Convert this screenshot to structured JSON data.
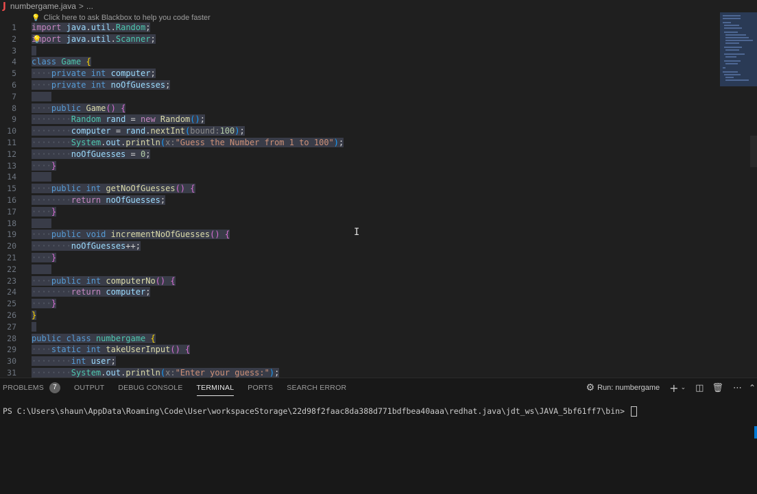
{
  "breadcrumb": {
    "file_icon": "J",
    "file": "numbergame.java",
    "sep": ">",
    "more": "..."
  },
  "codelens": {
    "text": "Click here to ask Blackbox to help you code faster"
  },
  "editor_lines": [
    {
      "n": "1"
    },
    {
      "n": "2"
    },
    {
      "n": "3"
    },
    {
      "n": "4"
    },
    {
      "n": "5"
    },
    {
      "n": "6"
    },
    {
      "n": "7"
    },
    {
      "n": "8"
    },
    {
      "n": "9"
    },
    {
      "n": "10"
    },
    {
      "n": "11"
    },
    {
      "n": "12"
    },
    {
      "n": "13"
    },
    {
      "n": "14"
    },
    {
      "n": "15"
    },
    {
      "n": "16"
    },
    {
      "n": "17"
    },
    {
      "n": "18"
    },
    {
      "n": "19"
    },
    {
      "n": "20"
    },
    {
      "n": "21"
    },
    {
      "n": "22"
    },
    {
      "n": "23"
    },
    {
      "n": "24"
    },
    {
      "n": "25"
    },
    {
      "n": "26"
    },
    {
      "n": "27"
    },
    {
      "n": "28"
    },
    {
      "n": "29"
    },
    {
      "n": "30"
    },
    {
      "n": "31"
    }
  ],
  "panel": {
    "tabs": [
      {
        "label": "PROBLEMS",
        "badge": "7"
      },
      {
        "label": "OUTPUT"
      },
      {
        "label": "DEBUG CONSOLE"
      },
      {
        "label": "TERMINAL",
        "active": true
      },
      {
        "label": "PORTS"
      },
      {
        "label": "SEARCH ERROR"
      }
    ],
    "run_label": "Run: numbergame"
  },
  "terminal": {
    "prompt": "PS C:\\Users\\shaun\\AppData\\Roaming\\Code\\User\\workspaceStorage\\22d98f2faac8da388d771bdfbea40aaa\\redhat.java\\jdt_ws\\JAVA_5bf61ff7\\bin> "
  },
  "icons": {
    "lightbulb": "lightbulb-icon",
    "gear": "gear-icon",
    "plus": "plus-icon",
    "chevron": "chevron-down-icon",
    "split": "split-terminal-icon",
    "trash": "trash-icon",
    "more": "more-icon",
    "collapse": "chevron-up-icon"
  },
  "colors": {
    "keyword": "#569cd6",
    "type": "#4ec9b0",
    "string": "#ce9178",
    "function": "#dcdcaa"
  }
}
